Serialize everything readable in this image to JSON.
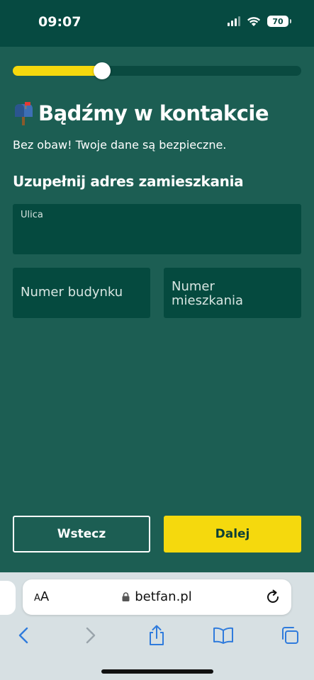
{
  "status_bar": {
    "time": "09:07",
    "battery": "70"
  },
  "progress": {
    "fraction": 0.31
  },
  "header": {
    "title": "Bądźmy w kontakcie",
    "icon": "mailbox-icon",
    "subtitle": "Bez obaw! Twoje dane są bezpieczne."
  },
  "form": {
    "section_title": "Uzupełnij adres zamieszkania",
    "street": {
      "label": "Ulica",
      "value": ""
    },
    "building": {
      "placeholder": "Numer budynku"
    },
    "flat": {
      "placeholder": "Numer mieszkania"
    }
  },
  "buttons": {
    "back": "Wstecz",
    "next": "Dalej"
  },
  "browser": {
    "aa_label_small": "A",
    "aa_label_large": "A",
    "url": "betfan.pl"
  },
  "colors": {
    "background": "#1c5e53",
    "status_bar": "#064a41",
    "field": "#054a3f",
    "accent_yellow": "#f5d90d",
    "browser_chrome": "#d7e0e3",
    "ios_blue": "#2f7bdc"
  }
}
